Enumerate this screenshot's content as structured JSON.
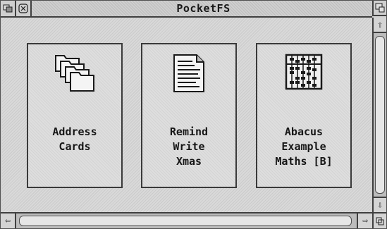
{
  "window": {
    "title": "PocketFS",
    "back_icon": "back-icon",
    "close_icon": "close-icon",
    "toggle_size_icon": "toggle-size-icon"
  },
  "items": [
    {
      "label": "Address\nCards",
      "icon": "stacked-folders-icon"
    },
    {
      "label": "Remind\nWrite\nXmas",
      "icon": "text-document-icon"
    },
    {
      "label": "Abacus\nExample\nMaths [B]",
      "icon": "abacus-icon"
    }
  ],
  "scrollbars": {
    "up_arrow": "⇧",
    "down_arrow": "⇩",
    "left_arrow": "⇦",
    "right_arrow": "⇨"
  }
}
